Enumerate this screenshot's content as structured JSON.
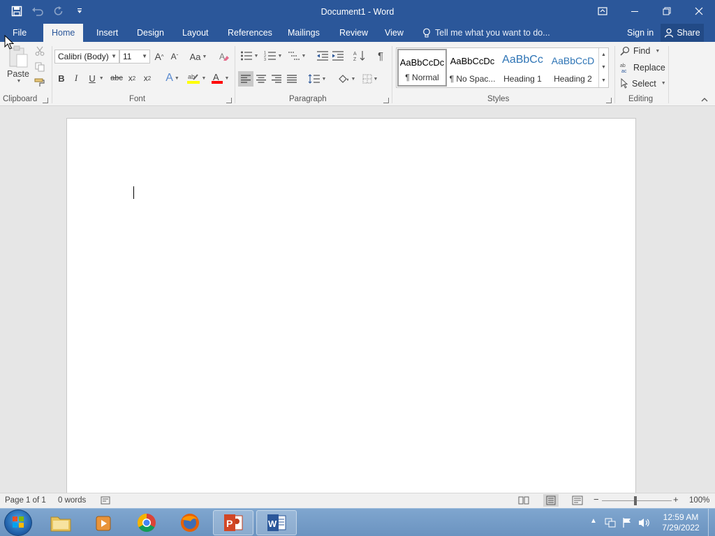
{
  "window": {
    "title": "Document1 - Word"
  },
  "tabs": {
    "file": "File",
    "home": "Home",
    "insert": "Insert",
    "design": "Design",
    "layout": "Layout",
    "references": "References",
    "mailings": "Mailings",
    "review": "Review",
    "view": "View"
  },
  "tellme": {
    "placeholder": "Tell me what you want to do..."
  },
  "account": {
    "signin": "Sign in",
    "share": "Share"
  },
  "clipboard": {
    "paste": "Paste",
    "label": "Clipboard"
  },
  "font": {
    "name": "Calibri (Body)",
    "size": "11",
    "change_case": "Aa",
    "bold": "B",
    "italic": "I",
    "underline": "U",
    "strike": "abc",
    "subscript_base": "x",
    "subscript": "2",
    "superscript_base": "x",
    "superscript": "2",
    "grow": "A",
    "shrink": "A",
    "text_effects": "A",
    "font_color": "A",
    "label": "Font"
  },
  "paragraph": {
    "label": "Paragraph",
    "show_marks": "¶"
  },
  "styles": {
    "label": "Styles",
    "items": [
      {
        "preview": "AaBbCcDc",
        "name": "¶ Normal"
      },
      {
        "preview": "AaBbCcDc",
        "name": "¶ No Spac..."
      },
      {
        "preview": "AaBbCc",
        "name": "Heading 1"
      },
      {
        "preview": "AaBbCcD",
        "name": "Heading 2"
      }
    ]
  },
  "editing": {
    "find": "Find",
    "replace": "Replace",
    "select": "Select",
    "label": "Editing"
  },
  "status": {
    "page": "Page 1 of 1",
    "words": "0 words",
    "zoom": "100%"
  },
  "clock": {
    "time": "12:59 AM",
    "date": "7/29/2022"
  },
  "colors": {
    "brand": "#2b579a",
    "highlight": "#ffff00",
    "font_color": "#ff0000",
    "heading": "#2e74b5"
  }
}
